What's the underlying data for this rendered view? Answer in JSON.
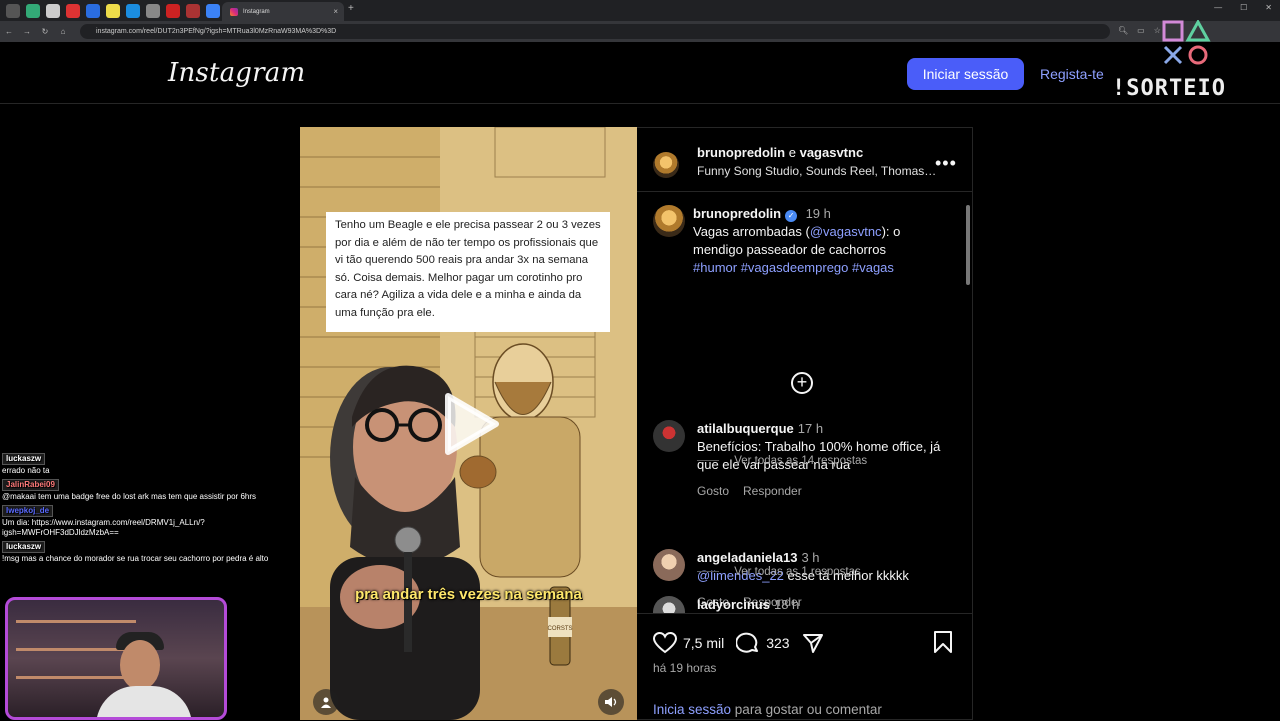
{
  "browser": {
    "tab_title": "Instagram",
    "url": "instagram.com/reel/DUT2n3PEfNg/?igsh=MTRua3l0MzRnaW93MA%3D%3D",
    "new_tab": "+",
    "tab_close": "×"
  },
  "header": {
    "logo": "Instagram",
    "login_button": "Iniciar sessão",
    "signup_link": "Regista-te"
  },
  "overlay": {
    "brand": "!SORTEIO"
  },
  "reel": {
    "caption": "Tenho um Beagle e ele precisa passear 2 ou 3 vezes por dia e além de não ter tempo os profissionais que vi tão querendo 500 reais pra andar 3x na semana só. Coisa demais. Melhor pagar um corotinho pro cara né? Agiliza a vida dele e a minha e ainda da uma função pra ele.",
    "subtitle": "pra andar três vezes na semana",
    "bottle_label": "CORSTS"
  },
  "post": {
    "author_names": "brunopredolin",
    "and_word": "e",
    "coauthor": "vagasvtnc",
    "audio": "Funny Song Studio, Sounds Reel, Thomas…",
    "more": "•••",
    "caption_author": "brunopredolin",
    "caption_time": "19 h",
    "caption_prefix": "Vagas arrombadas (",
    "caption_mention": "@vagasvtnc",
    "caption_suffix": "): o mendigo passeador de cachorros",
    "hashtags": "#humor #vagasdeemprego #vagas"
  },
  "comments": [
    {
      "user": "atilalbuquerque",
      "time": "17 h",
      "text": "Benefícios: Trabalho 100% home office, já que ele vai passear na rua",
      "like": "Gosto",
      "reply": "Responder",
      "view_replies": "Ver todas as 14 respostas"
    },
    {
      "user": "angeladaniela13",
      "time": "3 h",
      "mention": "@limendes_22",
      "text": " esse tá melhor kkkkk",
      "like": "Gosto",
      "reply": "Responder",
      "view_replies": "Ver todas as 1 respostas"
    },
    {
      "user": "ladyorcinus",
      "time": "18 h"
    }
  ],
  "actions": {
    "likes": "7,5 mil",
    "comments": "323",
    "time_ago": "há 19 horas",
    "login_link": "Inicia sessão",
    "login_rest": " para gostar ou comentar"
  },
  "chat": [
    {
      "user": "luckaszw",
      "msg": "errado não ta"
    },
    {
      "user": "JalinRabei09",
      "msg": "@makaai tem uma badge free do lost ark mas tem que assistir por 6hrs"
    },
    {
      "user": "Iwepkoj_de",
      "msg": "Um dia: https://www.instagram.com/reel/DRMV1j_ALLn/?igsh=MWFrOHF3dDJldzMzbA=="
    },
    {
      "user": "luckaszw",
      "msg": "!msg mas a chance do morador se rua trocar seu cachorro por pedra é alto"
    }
  ],
  "colors": {
    "accent": "#4a5df9",
    "link": "#8ea0ff",
    "webcam_border": "#b44bd8"
  }
}
